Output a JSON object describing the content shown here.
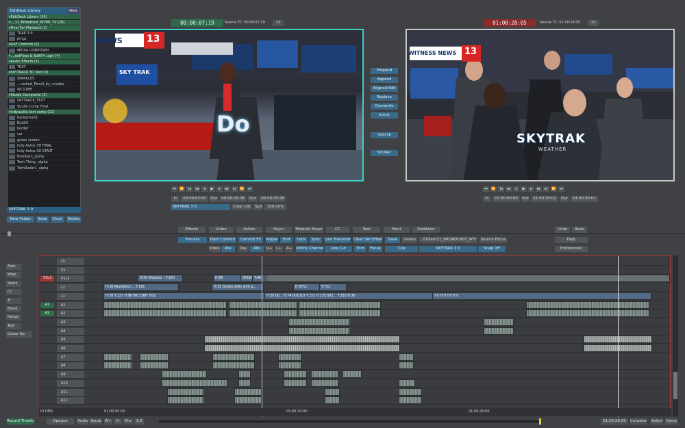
{
  "library": {
    "title": "EditDesk Library",
    "view_label": "View",
    "items": [
      {
        "label": "EditDesk Library (26)",
        "type": "bin"
      },
      {
        "label": "....11_Broadcast_WTHR_TV (28)",
        "type": "bin"
      },
      {
        "label": "Final For Playback (2)",
        "type": "bin"
      },
      {
        "label": "TRAK 3 0",
        "type": "clip"
      },
      {
        "label": "pings",
        "type": "clip"
      },
      {
        "label": "AAF Conform (2)",
        "type": "bin"
      },
      {
        "label": "MEDIA COMPOSER",
        "type": "clip"
      },
      {
        "label": "....extFixes & SoftFX copy (4)",
        "type": "bin"
      },
      {
        "label": "Audio Effects (1)",
        "type": "bin"
      },
      {
        "label": "TEXT",
        "type": "clip"
      },
      {
        "label": "SKYTRACK 3D Text (3)",
        "type": "bin"
      },
      {
        "label": "SPARKLES",
        "type": "clip"
      },
      {
        "label": "...rushed_Pencil_by_rsrcalor",
        "type": "clip"
      },
      {
        "label": "WC11BH",
        "type": "clip"
      },
      {
        "label": "Studio Composite (2)",
        "type": "bin"
      },
      {
        "label": "SKYTRACK_TEXT",
        "type": "clip"
      },
      {
        "label": "Studio Comp Final",
        "type": "clip"
      },
      {
        "label": "indyaudio.com comp (11)",
        "type": "bin"
      },
      {
        "label": "background",
        "type": "clip"
      },
      {
        "label": "BLACK",
        "type": "clip"
      },
      {
        "label": "border",
        "type": "clip"
      },
      {
        "label": "car",
        "type": "clip"
      },
      {
        "label": "green screen",
        "type": "clip"
      },
      {
        "label": "Indy Autos 3D FINAL",
        "type": "clip"
      },
      {
        "label": "Indy Autos 3D START",
        "type": "clip"
      },
      {
        "label": "Numbers_alpha",
        "type": "clip"
      },
      {
        "label": "Tech Thing _alpha",
        "type": "clip"
      },
      {
        "label": "TechRadar1_alpha",
        "type": "clip"
      }
    ],
    "selected_name": "SKYTRAK 3 0",
    "buttons": [
      "New Folder",
      "Save",
      "Clear",
      "Delete"
    ]
  },
  "source": {
    "timecode": "00:00:07:19",
    "label": "Source TC: 00:00:07:19",
    "speed": "1x",
    "in_label": "In",
    "in_tc": "00:00:03:00",
    "out_label": "Out",
    "out_tc": "00:00:29:28",
    "dur_label": "Dur",
    "dur_tc": "00:00:25:28",
    "clip_name": "SKYTRAK 3 0",
    "clear_list": "Clear List",
    "spd_label": "Spd",
    "spd_value": "100.00%",
    "overlay_logo": "NEWS",
    "logo_number": "13",
    "skytrak": "SKY TRAK",
    "overlay_text": "Do"
  },
  "record": {
    "timecode": "01:00:28:05",
    "label": "Source TC: 01:00:28:05",
    "speed": "1x",
    "in_label": "In",
    "in_tc": "01:00:00:00",
    "out_label": "Out",
    "out_tc": "01:00:30:02",
    "dur_label": "Dur",
    "dur_tc": "01:00:30:02",
    "overlay_logo": "WITNESS NEWS",
    "logo_number": "13",
    "brand": "SKYTRAK",
    "brand_sub": "WEATHER"
  },
  "edit_buttons": [
    "Prepend",
    "Append",
    "Aligned Edit",
    "Replace",
    "Overwrite",
    "Insert"
  ],
  "subclip": "Subclip",
  "src_rec": "Src/Rec",
  "toolbar": {
    "row1": [
      "Effects",
      "Video",
      "Action",
      "Keyer",
      "Modular Keyer",
      "CC",
      "Text",
      "Paint",
      "Stabilizer"
    ],
    "row2": [
      "Process",
      "Hard Commit",
      "Commit FX",
      "Ripple",
      "End",
      "Lock",
      "Sync",
      "Low Transition",
      "Clear Sel Offset",
      "Save",
      "Delete",
      "...01Dent11_BROADCAST_WTHR-TV",
      "Source Focus"
    ],
    "row3": [
      "Video",
      "Alix",
      "Pas",
      "Alix",
      "V+",
      "L+",
      "A+",
      "Unlink Channel",
      "Low Cut",
      "Trim",
      "Focus",
      "Clip",
      "SKYTRAK 3 0",
      "Snap Off"
    ],
    "right": [
      "Undo",
      "Redo",
      "Help",
      "Preferences"
    ]
  },
  "side_buttons": [
    "Auto",
    "Wipe",
    "Spark",
    "CC",
    "Tr",
    "Blend",
    "Resize",
    "Text",
    "Colour Src"
  ],
  "tracks": [
    {
      "name": "L5"
    },
    {
      "name": "V1"
    },
    {
      "name": "V1L3",
      "patch": "V1L3"
    },
    {
      "name": "L2"
    },
    {
      "name": "L1"
    },
    {
      "name": "A1",
      "patch": "A1"
    },
    {
      "name": "A2",
      "patch": "A2"
    },
    {
      "name": "A3"
    },
    {
      "name": "A4"
    },
    {
      "name": "A5"
    },
    {
      "name": "A6"
    },
    {
      "name": "A7"
    },
    {
      "name": "A8"
    },
    {
      "name": "A9"
    },
    {
      "name": "A10"
    },
    {
      "name": "A11"
    },
    {
      "name": "A12"
    }
  ],
  "clip_labels": {
    "weather": "H:50 Weather - T:183",
    "h88": "H:88",
    "d0202": "0D0202",
    "t46": "T:46",
    "revelation": "H:30 Revelation... T:181",
    "studio": "H:32 Studio dolly with g...",
    "h3711": "H:3711",
    "t752": "T:752",
    "l1": "H:30 T:127 H:98 WC11BH T:62",
    "l1b": "H:30 00... H:74 001010 T:151 H:155 003... T:332 H:36",
    "t0": "T:0 H:0 T:0 H:0"
  },
  "ruler": [
    "01:00:00:00",
    "01:00:10:00",
    "01:00:20:00"
  ],
  "status": {
    "left": "10 DEN",
    "view": "Record Timeline",
    "opaque": "Opaque",
    "audio": "Audio",
    "scrub": "Scrub",
    "w": "W+",
    "h": "H-",
    "pre": "Pre",
    "num": "3.0",
    "tc": "01:00:28:05",
    "inclusive": "Inclusive",
    "select": "Select",
    "home": "Home"
  }
}
